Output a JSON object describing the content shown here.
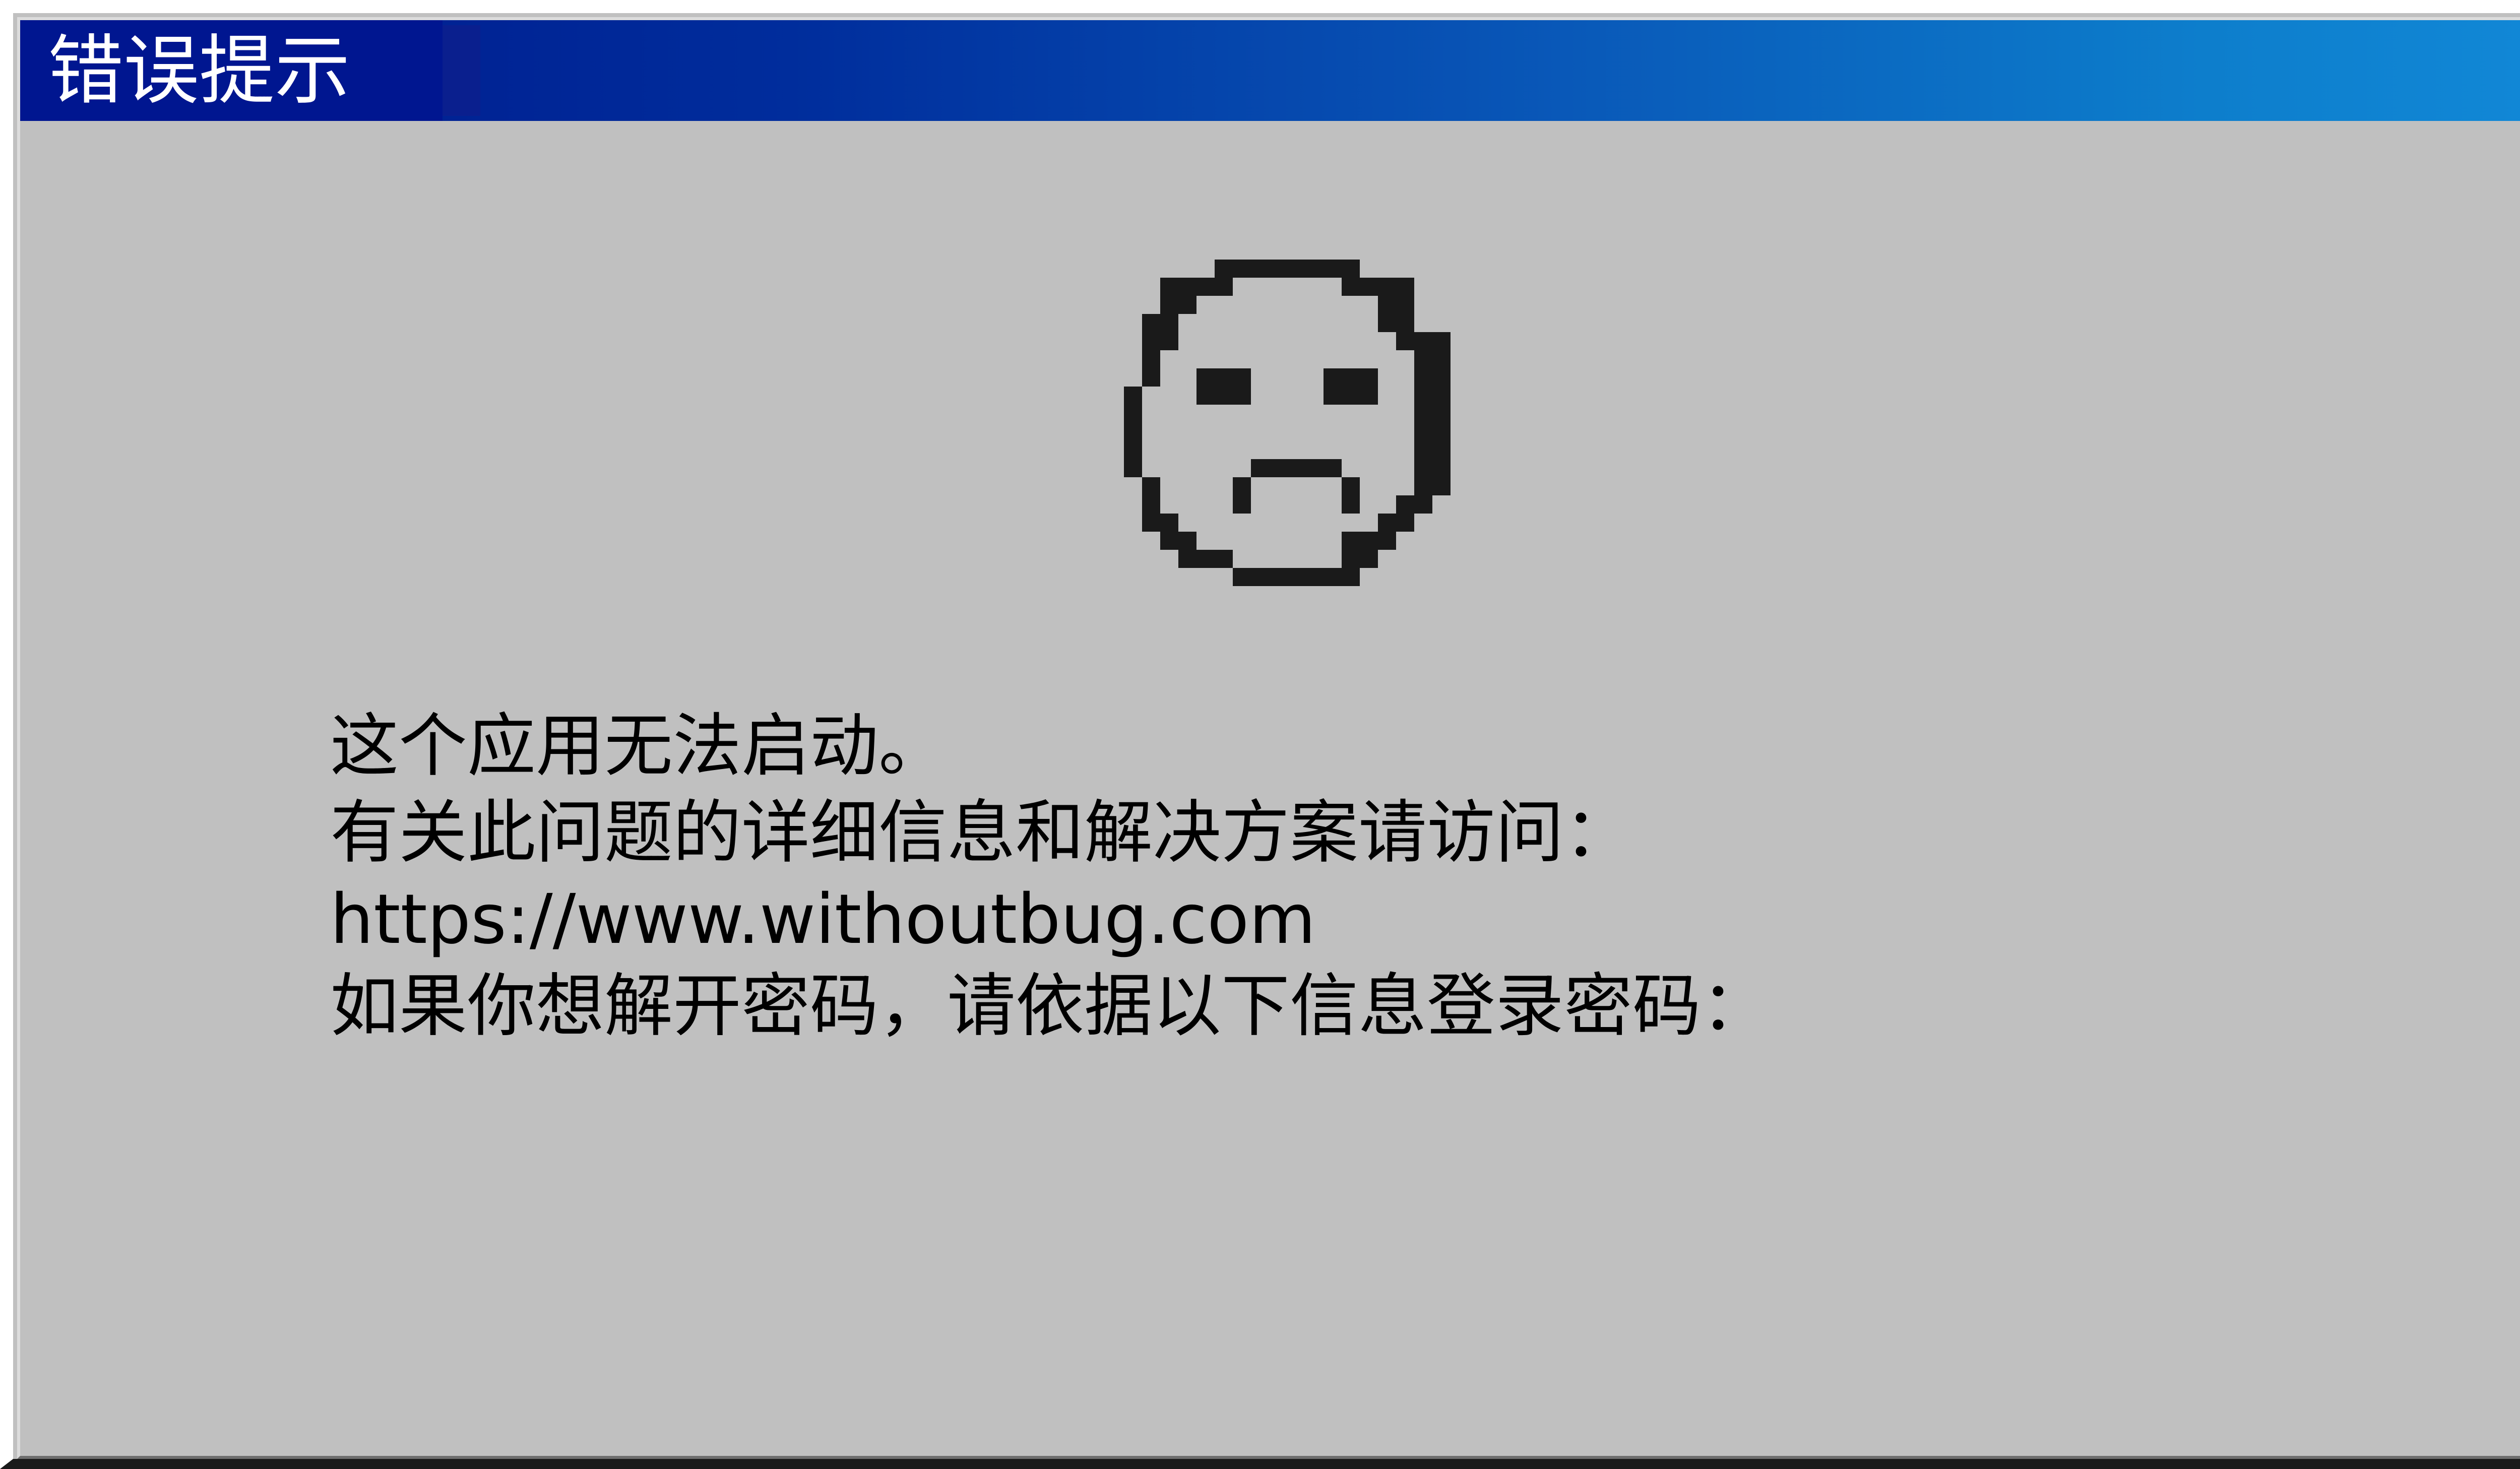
{
  "window": {
    "title": "错误提示",
    "colors": {
      "background": "#c0c0c0",
      "title_bar_start": "#00168a",
      "title_bar_end": "#1289d8",
      "title_text": "#ffffff",
      "body_text": "#000000"
    }
  },
  "face": {
    "icon": "sad-face-icon"
  },
  "message": {
    "line1": "这个应用无法启动。",
    "line2": "有关此问题的详细信息和解决方案请访问：",
    "line3": "https://www.withoutbug.com",
    "line4": "如果你想解开密码，请依据以下信息登录密码："
  }
}
